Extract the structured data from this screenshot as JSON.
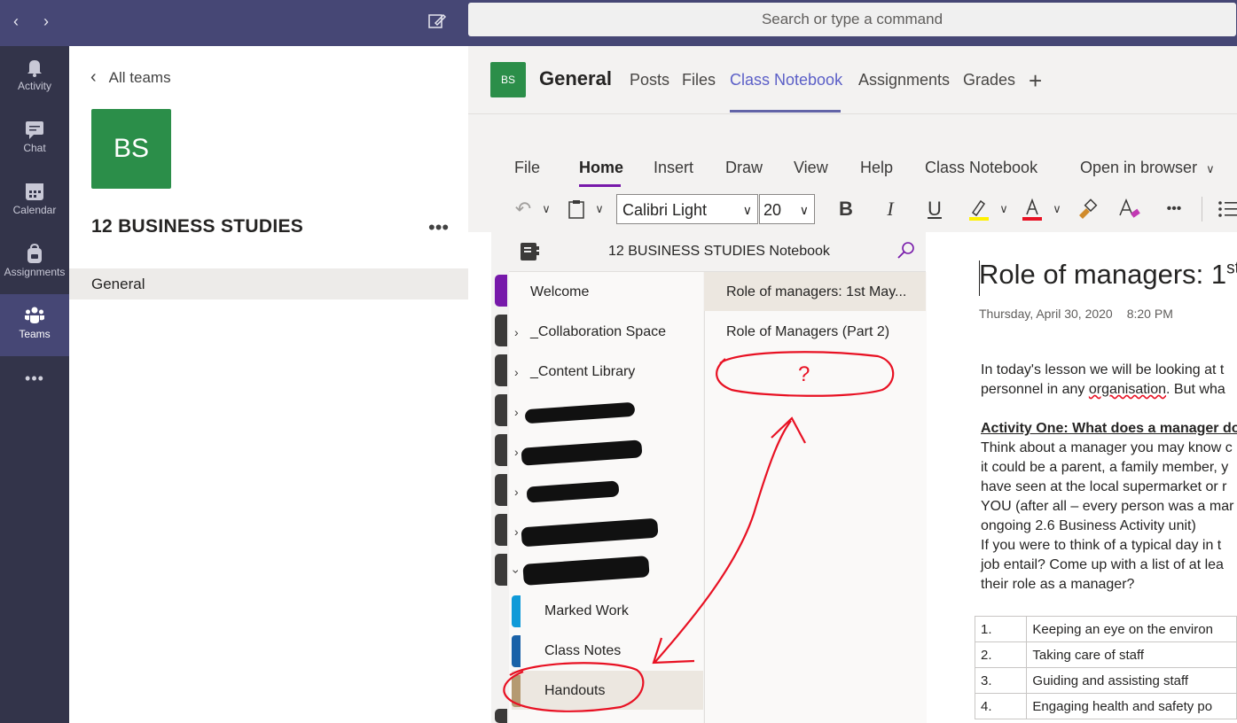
{
  "search": {
    "placeholder": "Search or type a command"
  },
  "rail": {
    "items": [
      {
        "label": "Activity",
        "icon": "bell-icon"
      },
      {
        "label": "Chat",
        "icon": "chat-icon"
      },
      {
        "label": "Calendar",
        "icon": "calendar-icon"
      },
      {
        "label": "Assignments",
        "icon": "backpack-icon"
      },
      {
        "label": "Teams",
        "icon": "teams-icon"
      }
    ],
    "more": "•••"
  },
  "team_pane": {
    "back_label": "All teams",
    "team_initials": "BS",
    "team_name": "12 BUSINESS STUDIES",
    "more": "•••",
    "channel": "General"
  },
  "header": {
    "initials": "BS",
    "channel_title": "General",
    "tabs": [
      "Posts",
      "Files",
      "Class Notebook",
      "Assignments",
      "Grades"
    ],
    "active_tab": "Class Notebook",
    "add_tab": "+"
  },
  "ribbon": {
    "tabs": [
      "File",
      "Home",
      "Insert",
      "Draw",
      "View",
      "Help",
      "Class Notebook"
    ],
    "active_tab": "Home",
    "open_in_browser": "Open in browser",
    "font_name": "Calibri Light",
    "font_size": "20",
    "bold": "B",
    "italic": "I",
    "underline": "U",
    "more": "•••",
    "highlight_color": "#fff100",
    "font_color": "#e81123"
  },
  "notebook": {
    "title": "12 BUSINESS STUDIES Notebook",
    "sections": [
      {
        "label": "Welcome"
      },
      {
        "label": "_Collaboration Space"
      },
      {
        "label": "_Content Library"
      }
    ],
    "subsections": [
      "Marked Work",
      "Class Notes",
      "Handouts"
    ],
    "selected_section": "Handouts",
    "pages": [
      "Role of managers: 1st May...",
      "Role of Managers (Part 2)"
    ],
    "annotation_mark": "?"
  },
  "page": {
    "title": "Role of managers: 1",
    "title_sup": "st",
    "date": "Thursday, April 30, 2020",
    "time": "8:20 PM",
    "intro_lines": [
      "In today's lesson we will be looking at t",
      "personnel in any organisation. But wha"
    ],
    "activity_heading": "Activity One: What does a manager do",
    "body_lines": [
      "Think about a manager you may know c",
      "it could be a parent, a family member, y",
      "have seen at the local supermarket or r",
      "YOU (after all – every person was a mar",
      "ongoing 2.6 Business Activity unit)",
      "If you were to think of a typical day in t",
      "job entail? Come up with a list of at lea",
      "their role as a manager?"
    ],
    "table": [
      {
        "num": "1.",
        "text": "Keeping an eye on the environ"
      },
      {
        "num": "2.",
        "text": "Taking care of staff"
      },
      {
        "num": "3.",
        "text": "Guiding and assisting staff"
      },
      {
        "num": "4.",
        "text": "Engaging health and safety po"
      }
    ]
  }
}
